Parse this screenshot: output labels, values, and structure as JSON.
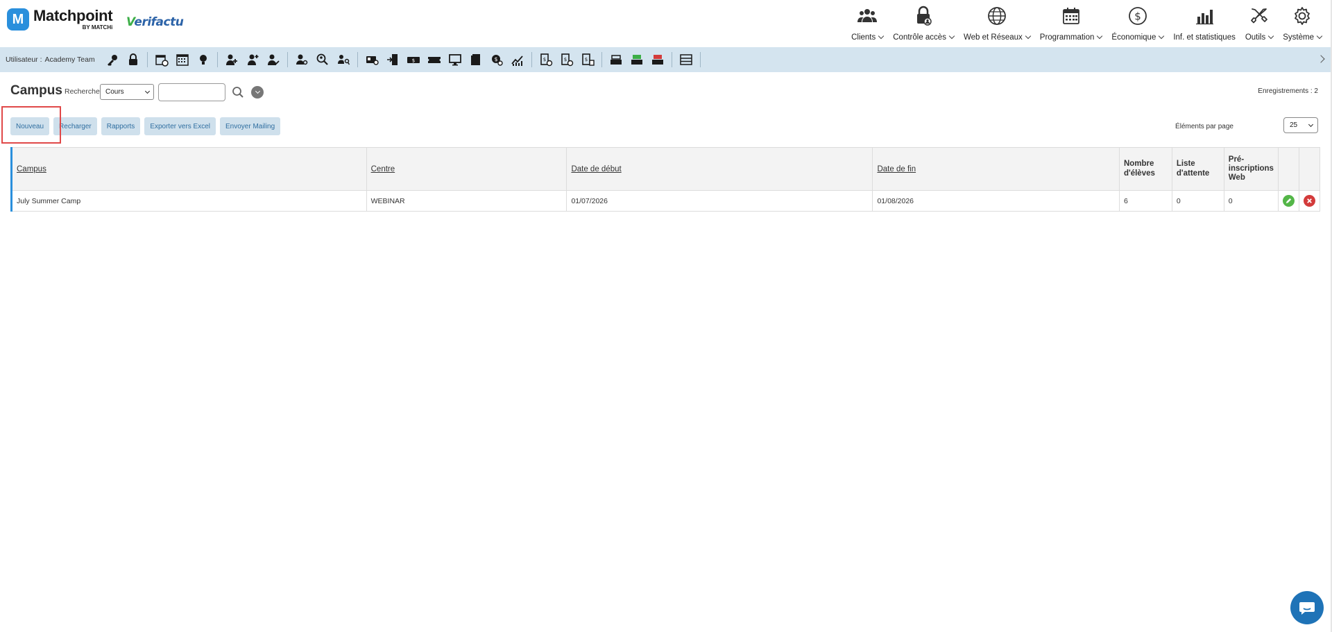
{
  "brand": {
    "name": "Matchpoint",
    "byline": "BY MATCHi",
    "logo_letter": "M",
    "partner_prefix": "V",
    "partner_rest": "erifactu",
    "accent": "#2a8fdc"
  },
  "topnav": [
    {
      "label": "Clients",
      "icon": "users-icon",
      "dropdown": true
    },
    {
      "label": "Contrôle accès",
      "icon": "access-lock-icon",
      "dropdown": true
    },
    {
      "label": "Web et Réseaux",
      "icon": "globe-icon",
      "dropdown": true
    },
    {
      "label": "Programmation",
      "icon": "calendar-icon",
      "dropdown": true
    },
    {
      "label": "Économique",
      "icon": "dollar-icon",
      "dropdown": true
    },
    {
      "label": "Inf. et statistiques",
      "icon": "bar-chart-icon",
      "dropdown": false
    },
    {
      "label": "Outils",
      "icon": "tools-icon",
      "dropdown": true
    },
    {
      "label": "Système",
      "icon": "gear-icon",
      "dropdown": true
    }
  ],
  "toolbar": {
    "user_label": "Utilisateur :",
    "user_name": "Academy Team"
  },
  "page": {
    "title": "Campus",
    "search_label": "Recherche",
    "search_select": "Cours",
    "search_value": "",
    "records": "Enregistrements : 2",
    "per_page_label": "Éléments par page",
    "per_page_value": "25"
  },
  "actions": {
    "new": "Nouveau",
    "reload": "Recharger",
    "reports": "Rapports",
    "export": "Exporter vers Excel",
    "mailing": "Envoyer Mailing"
  },
  "table": {
    "headers": {
      "campus": "Campus",
      "centre": "Centre",
      "start": "Date de début",
      "end": "Date de fin",
      "students": "Nombre d'élèves",
      "waitlist": "Liste d'attente",
      "prereg": "Pré-inscriptions Web"
    },
    "rows": [
      {
        "campus": "July Summer Camp",
        "centre": "WEBINAR",
        "start": "01/07/2026",
        "end": "01/08/2026",
        "students": "6",
        "waitlist": "0",
        "prereg": "0"
      }
    ]
  },
  "colors": {
    "toolbar_bg": "#d4e4ef",
    "button_bg": "#cfe0ec",
    "button_text": "#2f6ea0",
    "edit": "#54b648",
    "delete": "#d33b3b",
    "highlight": "#e04848",
    "chat": "#1f73b7"
  }
}
